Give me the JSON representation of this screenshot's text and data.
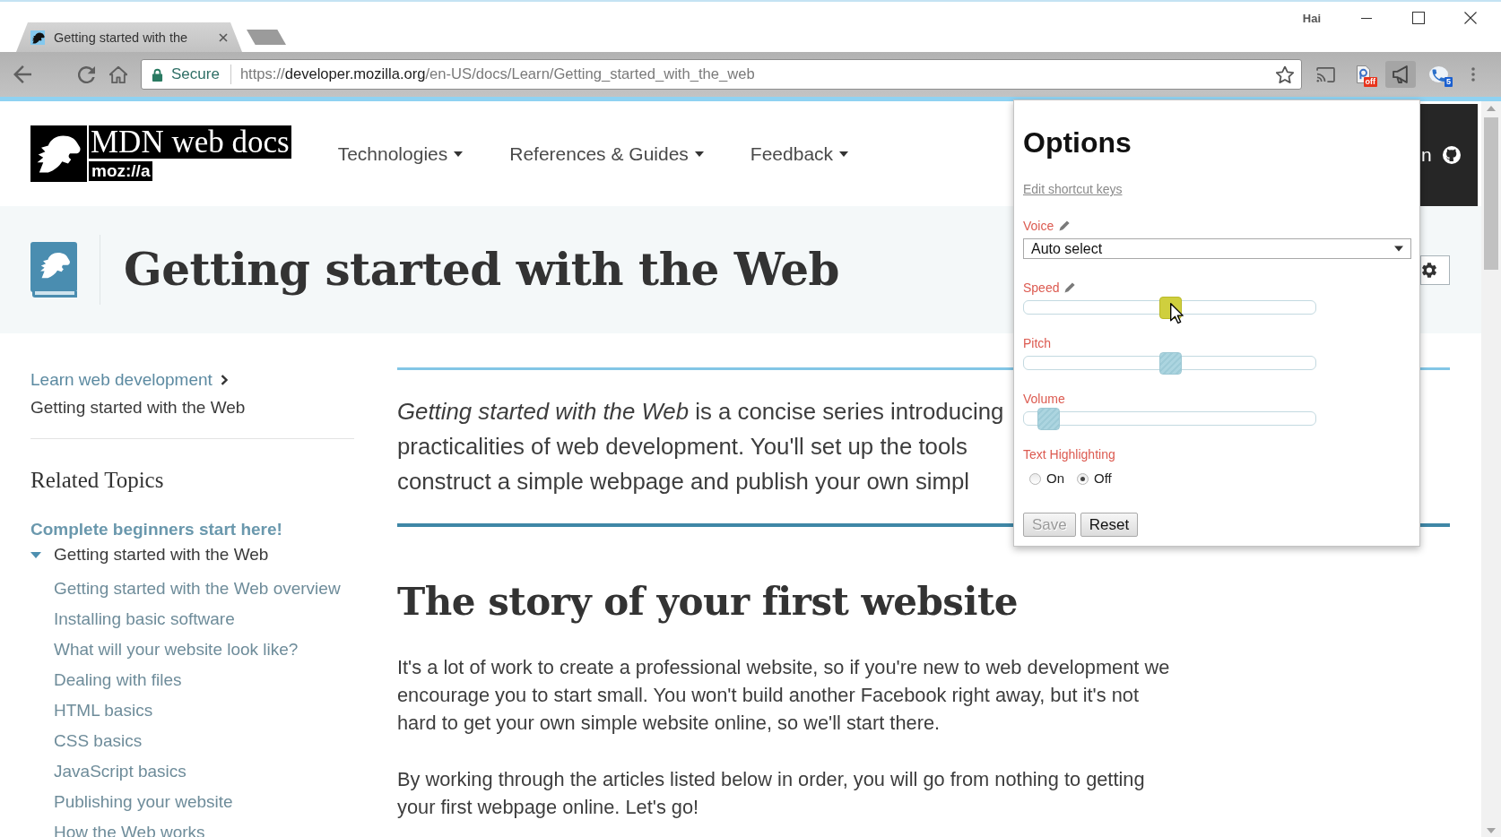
{
  "browser": {
    "tabs": [
      {
        "title": "Getting started with the",
        "selected": true
      }
    ],
    "profile": "Hai",
    "address_bar": {
      "secure_label": "Secure",
      "url": {
        "scheme": "https://",
        "host": "developer.mozilla.org",
        "path": "/en-US/docs/Learn/Getting_started_with_the_web"
      }
    },
    "extensions": [
      {
        "kind": "cast",
        "active": false
      },
      {
        "kind": "document",
        "active": false,
        "badge": {
          "text": "off",
          "color": "#e8341c"
        }
      },
      {
        "kind": "megaphone",
        "active": true
      },
      {
        "kind": "phone",
        "active": false,
        "badge": {
          "text": "5",
          "color": "#1a5fd0"
        }
      }
    ]
  },
  "site_header": {
    "logo": {
      "wordmark": "MDN web docs",
      "subtitle": "moz://a"
    },
    "nav": [
      {
        "label": "Technologies"
      },
      {
        "label": "References & Guides"
      },
      {
        "label": "Feedback"
      }
    ],
    "account_label": "n"
  },
  "title_band": {
    "title": "Getting started with the Web"
  },
  "sidebar": {
    "breadcrumbs": [
      {
        "label": "Learn web development"
      }
    ],
    "current": "Getting started with the Web",
    "related_title": "Related Topics",
    "tree": [
      {
        "label": "Complete beginners start here!",
        "children": [
          {
            "label": "Getting started with the Web",
            "expanded": true,
            "children": [
              {
                "label": "Getting started with the Web overview"
              },
              {
                "label": "Installing basic software"
              },
              {
                "label": "What will your website look like?"
              },
              {
                "label": "Dealing with files"
              },
              {
                "label": "HTML basics"
              },
              {
                "label": "CSS basics"
              },
              {
                "label": "JavaScript basics"
              },
              {
                "label": "Publishing your website"
              },
              {
                "label": "How the Web works"
              }
            ]
          }
        ]
      }
    ]
  },
  "article": {
    "intro_lines": [
      "*Getting started with the Web* is a concise series introducing",
      "practicalities of web development. You'll set up the tools",
      "construct a simple webpage and publish your own simpl"
    ],
    "heading": "The story of your first website",
    "paragraphs": [
      {
        "lines": [
          "It's a lot of work to create a professional website, so if you're new to web development we",
          "encourage you to start small. You won't build another Facebook right away, but it's not",
          "hard to get your own simple website online, so we'll start there."
        ]
      },
      {
        "lines": [
          "By working through the articles listed below in order, you will go from nothing to getting",
          "your first webpage online. Let's go!"
        ]
      }
    ]
  },
  "options": {
    "title": "Options",
    "shortcut_link": "Edit shortcut keys",
    "fields": [
      {
        "kind": "select",
        "label": "Voice",
        "edit_icon": true,
        "value": "Auto select"
      },
      {
        "kind": "slider",
        "label": "Speed",
        "edit_icon": true,
        "level": 0.5,
        "hovered": true
      },
      {
        "kind": "slider",
        "label": "Pitch",
        "edit_icon": false,
        "level": 0.5,
        "hovered": false
      },
      {
        "kind": "slider",
        "label": "Volume",
        "edit_icon": false,
        "level": 0.05,
        "hovered": false
      },
      {
        "kind": "radio",
        "label": "Text Highlighting",
        "edit_icon": false,
        "options": [
          {
            "label": "On",
            "selected": false
          },
          {
            "label": "Off",
            "selected": true
          }
        ]
      }
    ],
    "buttons": [
      {
        "label": "Save",
        "disabled": true
      },
      {
        "label": "Reset",
        "disabled": false
      }
    ]
  }
}
